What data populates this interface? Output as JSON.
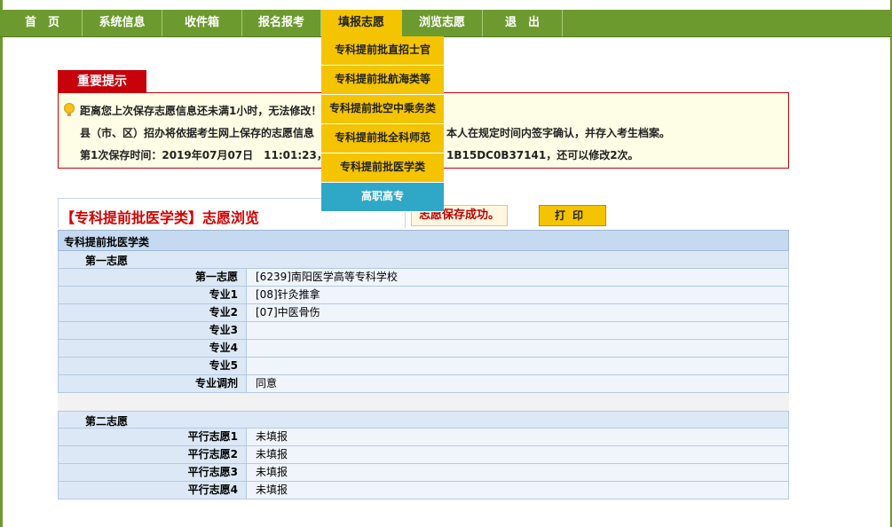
{
  "nav": {
    "items": [
      "首　页",
      "系统信息",
      "收件箱",
      "报名报考",
      "填报志愿",
      "浏览志愿",
      "退　出"
    ],
    "active_index": 4
  },
  "dropdown": {
    "items": [
      "专科提前批直招士官",
      "专科提前批航海类等",
      "专科提前批空中乘务类",
      "专科提前批全科师范",
      "专科提前批医学类",
      "高职高专"
    ]
  },
  "notice": {
    "tab": "重要提示",
    "line1": "距离您上次保存志愿信息还未满1小时，无法修改！",
    "line2": "县（市、区）招办将依据考生网上保存的志愿信息",
    "line2b": "本人在规定时间内签字确认，并存入考生档案。",
    "line3": "第1次保存时间：2019年07月07日　11:01:23，校验",
    "line3b": "1B15DC0B37141，还可以修改2次。"
  },
  "browse": {
    "title": "【专科提前批医学类】志愿浏览",
    "save_success": "志愿保存成功。",
    "print": "打印"
  },
  "table": {
    "group_title": "专科提前批医学类",
    "first_title": "第一志愿",
    "first_rows": [
      {
        "label": "第一志愿",
        "value": "[6239]南阳医学高等专科学校"
      },
      {
        "label": "专业1",
        "value": "[08]针灸推拿"
      },
      {
        "label": "专业2",
        "value": "[07]中医骨伤"
      },
      {
        "label": "专业3",
        "value": ""
      },
      {
        "label": "专业4",
        "value": ""
      },
      {
        "label": "专业5",
        "value": ""
      },
      {
        "label": "专业调剂",
        "value": "同意"
      }
    ],
    "second_title": "第二志愿",
    "second_rows": [
      {
        "label": "平行志愿1",
        "value": "未填报"
      },
      {
        "label": "平行志愿2",
        "value": "未填报"
      },
      {
        "label": "平行志愿3",
        "value": "未填报"
      },
      {
        "label": "平行志愿4",
        "value": "未填报"
      }
    ]
  },
  "colors": {
    "nav_green": "#6c9a2e",
    "nav_active_yellow": "#f5c400",
    "notice_red": "#c8000a",
    "table_blue": "#c5d9f1"
  }
}
